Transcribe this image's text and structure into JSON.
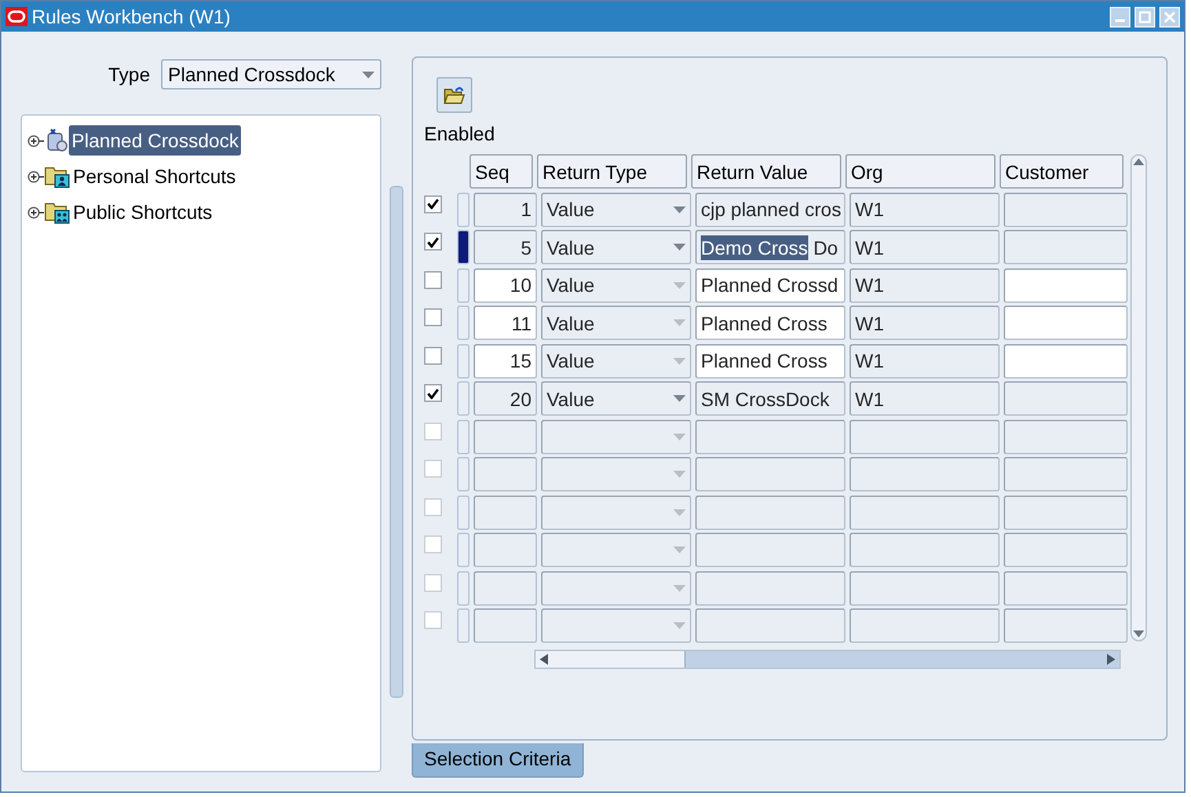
{
  "window": {
    "title": "Rules Workbench (W1)"
  },
  "type_field": {
    "label": "Type",
    "value": "Planned Crossdock"
  },
  "tree": [
    {
      "label": "Planned Crossdock",
      "kind": "rules",
      "selected": true,
      "expanded": false
    },
    {
      "label": "Personal Shortcuts",
      "kind": "personal",
      "selected": false,
      "expanded": false
    },
    {
      "label": "Public Shortcuts",
      "kind": "public",
      "selected": false,
      "expanded": false
    }
  ],
  "grid": {
    "enabled_label": "Enabled",
    "columns": [
      "Seq",
      "Return Type",
      "Return Value",
      "Org",
      "Customer"
    ],
    "rows": [
      {
        "enabled": true,
        "current": false,
        "editable": false,
        "seq": "1",
        "return_type": "Value",
        "return_value": [
          {
            "text": "cjp planned cros",
            "selected": false
          }
        ],
        "org": "W1"
      },
      {
        "enabled": true,
        "current": true,
        "editable": false,
        "seq": "5",
        "return_type": "Value",
        "return_value": [
          {
            "text": "Demo Cross",
            "selected": true
          },
          {
            "text": "Do",
            "selected": false
          }
        ],
        "org": "W1"
      },
      {
        "enabled": false,
        "current": false,
        "editable": true,
        "seq": "10",
        "return_type": "Value",
        "return_value": [
          {
            "text": "Planned Crossd",
            "selected": false
          }
        ],
        "org": "W1"
      },
      {
        "enabled": false,
        "current": false,
        "editable": true,
        "seq": "11",
        "return_type": "Value",
        "return_value": [
          {
            "text": "Planned Cross",
            "selected": false
          }
        ],
        "org": "W1"
      },
      {
        "enabled": false,
        "current": false,
        "editable": true,
        "seq": "15",
        "return_type": "Value",
        "return_value": [
          {
            "text": "Planned Cross",
            "selected": false
          }
        ],
        "org": "W1"
      },
      {
        "enabled": true,
        "current": false,
        "editable": false,
        "seq": "20",
        "return_type": "Value",
        "return_value": [
          {
            "text": "SM CrossDock",
            "selected": false
          }
        ],
        "org": "W1"
      },
      {
        "enabled": false,
        "current": false,
        "editable": false
      },
      {
        "enabled": false,
        "current": false,
        "editable": false
      },
      {
        "enabled": false,
        "current": false,
        "editable": false
      },
      {
        "enabled": false,
        "current": false,
        "editable": false
      },
      {
        "enabled": false,
        "current": false,
        "editable": false
      },
      {
        "enabled": false,
        "current": false,
        "editable": false
      }
    ]
  },
  "tabs": [
    {
      "label": "Selection Criteria",
      "selected": true
    }
  ]
}
